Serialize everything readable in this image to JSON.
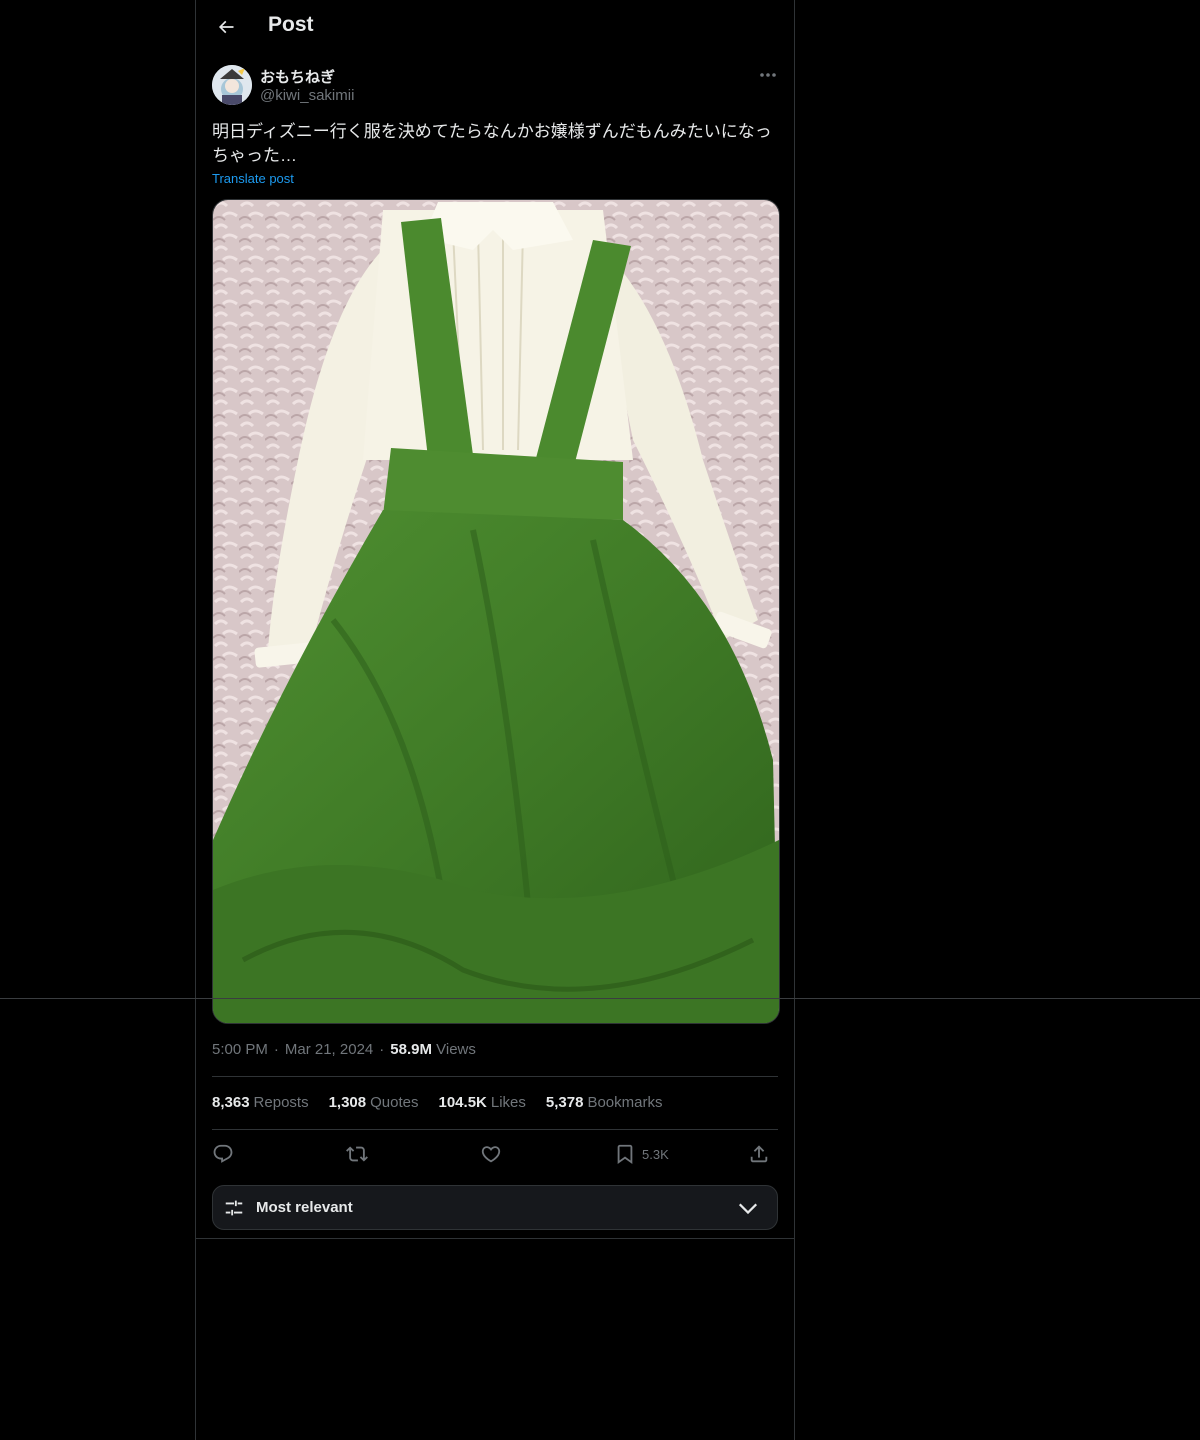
{
  "header": {
    "title": "Post"
  },
  "post": {
    "author": {
      "display_name": "おもちねぎ",
      "handle": "@kiwi_sakimii"
    },
    "text": "明日ディズニー行く服を決めてたらなんかお嬢様ずんだもんみたいになっちゃった…",
    "translate_label": "Translate post",
    "time": "5:00 PM",
    "date": "Mar 21, 2024",
    "views_count": "58.9M",
    "views_label": "Views",
    "stats": [
      {
        "count": "8,363",
        "label": "Reposts"
      },
      {
        "count": "1,308",
        "label": "Quotes"
      },
      {
        "count": "104.5K",
        "label": "Likes"
      },
      {
        "count": "5,378",
        "label": "Bookmarks"
      }
    ],
    "actions": {
      "bookmark_count": "5.3K"
    }
  },
  "replies_sort": {
    "label": "Most relevant"
  },
  "icons": {
    "back": "back-arrow-icon",
    "more": "more-dots-icon",
    "reply": "reply-icon",
    "repost": "repost-icon",
    "like": "heart-icon",
    "bookmark": "bookmark-icon",
    "share": "share-icon",
    "sort": "sliders-icon",
    "chevron": "chevron-down-icon"
  },
  "colors": {
    "background": "#000000",
    "text": "#e7e9ea",
    "muted": "#71767b",
    "link": "#1d9bf0",
    "border": "#2f3336"
  }
}
